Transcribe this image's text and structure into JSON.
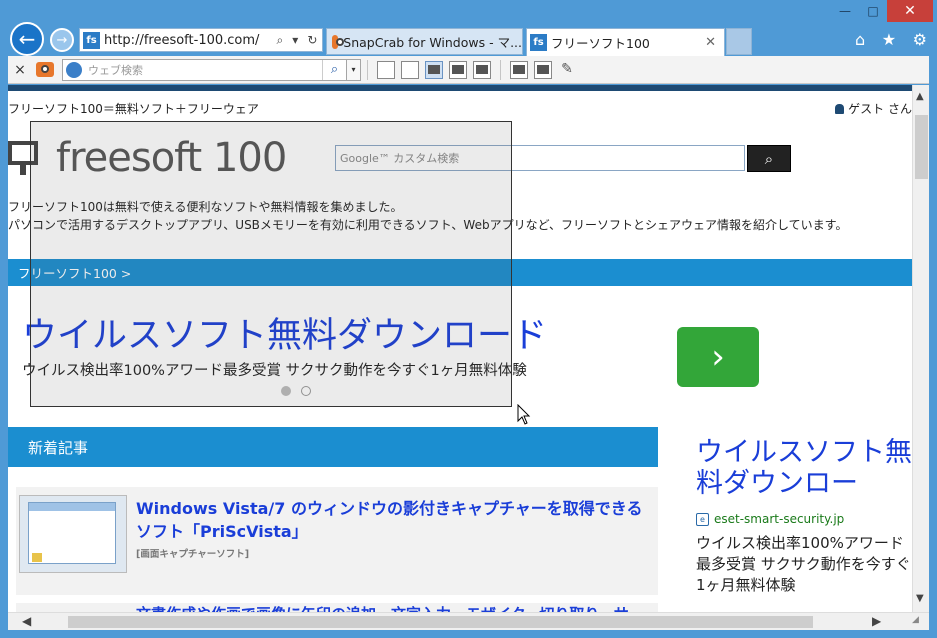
{
  "browser": {
    "address_url": "http://freesoft-100.com/",
    "address_favicon": "fs",
    "tabs": [
      {
        "label": "SnapCrab for Windows - マ...",
        "icon": "camera-icon"
      },
      {
        "label": "フリーソフト100",
        "icon": "fs-favicon",
        "active": true
      }
    ],
    "window_buttons": {
      "minimize": "—",
      "maximize": "□",
      "close": "✕"
    },
    "right_icons": [
      "home-icon",
      "star-icon",
      "gear-icon"
    ]
  },
  "command_bar": {
    "close_glyph": "×",
    "search_placeholder": "ウェブ検索",
    "search_glyph": "⌕",
    "dropdown_glyph": "▾"
  },
  "page": {
    "tagline": "フリーソフト100＝無料ソフト＋フリーウェア",
    "guest": "ゲスト さん",
    "logo_text": "freesoft 100",
    "google_search_placeholder": "Google™ カスタム検索",
    "search_button_glyph": "⌕",
    "description_line1": "フリーソフト100は無料で使える便利なソフトや無料情報を集めました。",
    "description_line2": "パソコンで活用するデスクトップアプリ、USBメモリーを有効に利用できるソフト、Webアプリなど、フリーソフトとシェアウェア情報を紹介しています。",
    "breadcrumb": "フリーソフト100 >",
    "ad": {
      "title": "ウイルスソフト無料ダウンロード",
      "subtitle": "ウイルス検出率100%アワード最多受賞 サクサク動作を今すぐ1ヶ月無料体験",
      "go_glyph": "›",
      "dots": 2,
      "active_dot": 0
    },
    "new_articles_header": "新着記事",
    "articles": [
      {
        "title": "Windows Vista/7 のウィンドウの影付きキャプチャーを取得できるソフト「PriScVista」",
        "category": "[画面キャプチャーソフト]"
      },
      {
        "title": "文書作成や作画で画像に矢印の追加、文字入力、モザイク、切り取り、サ"
      }
    ],
    "sidebar_ad": {
      "title": "ウイルスソフト無料ダウンロー",
      "domain": "eset-smart-security.jp",
      "favicon": "e",
      "text": "ウイルス検出率100%アワード最多受賞 サクサク動作を今すぐ1ヶ月無料体験"
    }
  },
  "scrollbars": {
    "up": "▲",
    "down": "▼",
    "left": "◀",
    "right": "▶"
  }
}
